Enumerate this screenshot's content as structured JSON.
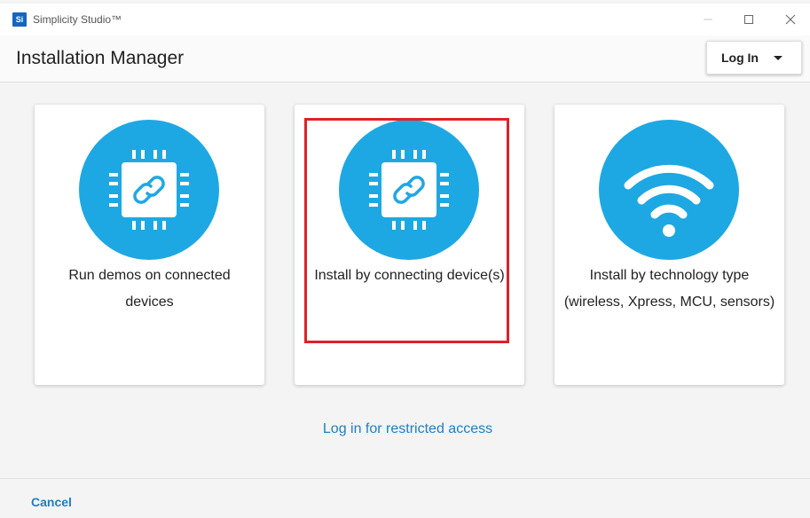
{
  "window": {
    "app_logo_text": "Si",
    "app_title": "Simplicity Studio™"
  },
  "header": {
    "title": "Installation Manager",
    "login_label": "Log In"
  },
  "cards": [
    {
      "label": "Run demos on connected devices",
      "icon": "chip-link-icon"
    },
    {
      "label": "Install by connecting device(s)",
      "icon": "chip-link-icon"
    },
    {
      "label": "Install by technology type (wireless, Xpress, MCU, sensors)",
      "icon": "wifi-icon"
    }
  ],
  "links": {
    "restricted_access": "Log in for restricted access"
  },
  "footer": {
    "cancel_label": "Cancel"
  },
  "colors": {
    "accent": "#1ea8e3",
    "link": "#1e7fc2",
    "highlight": "#e0202a"
  }
}
